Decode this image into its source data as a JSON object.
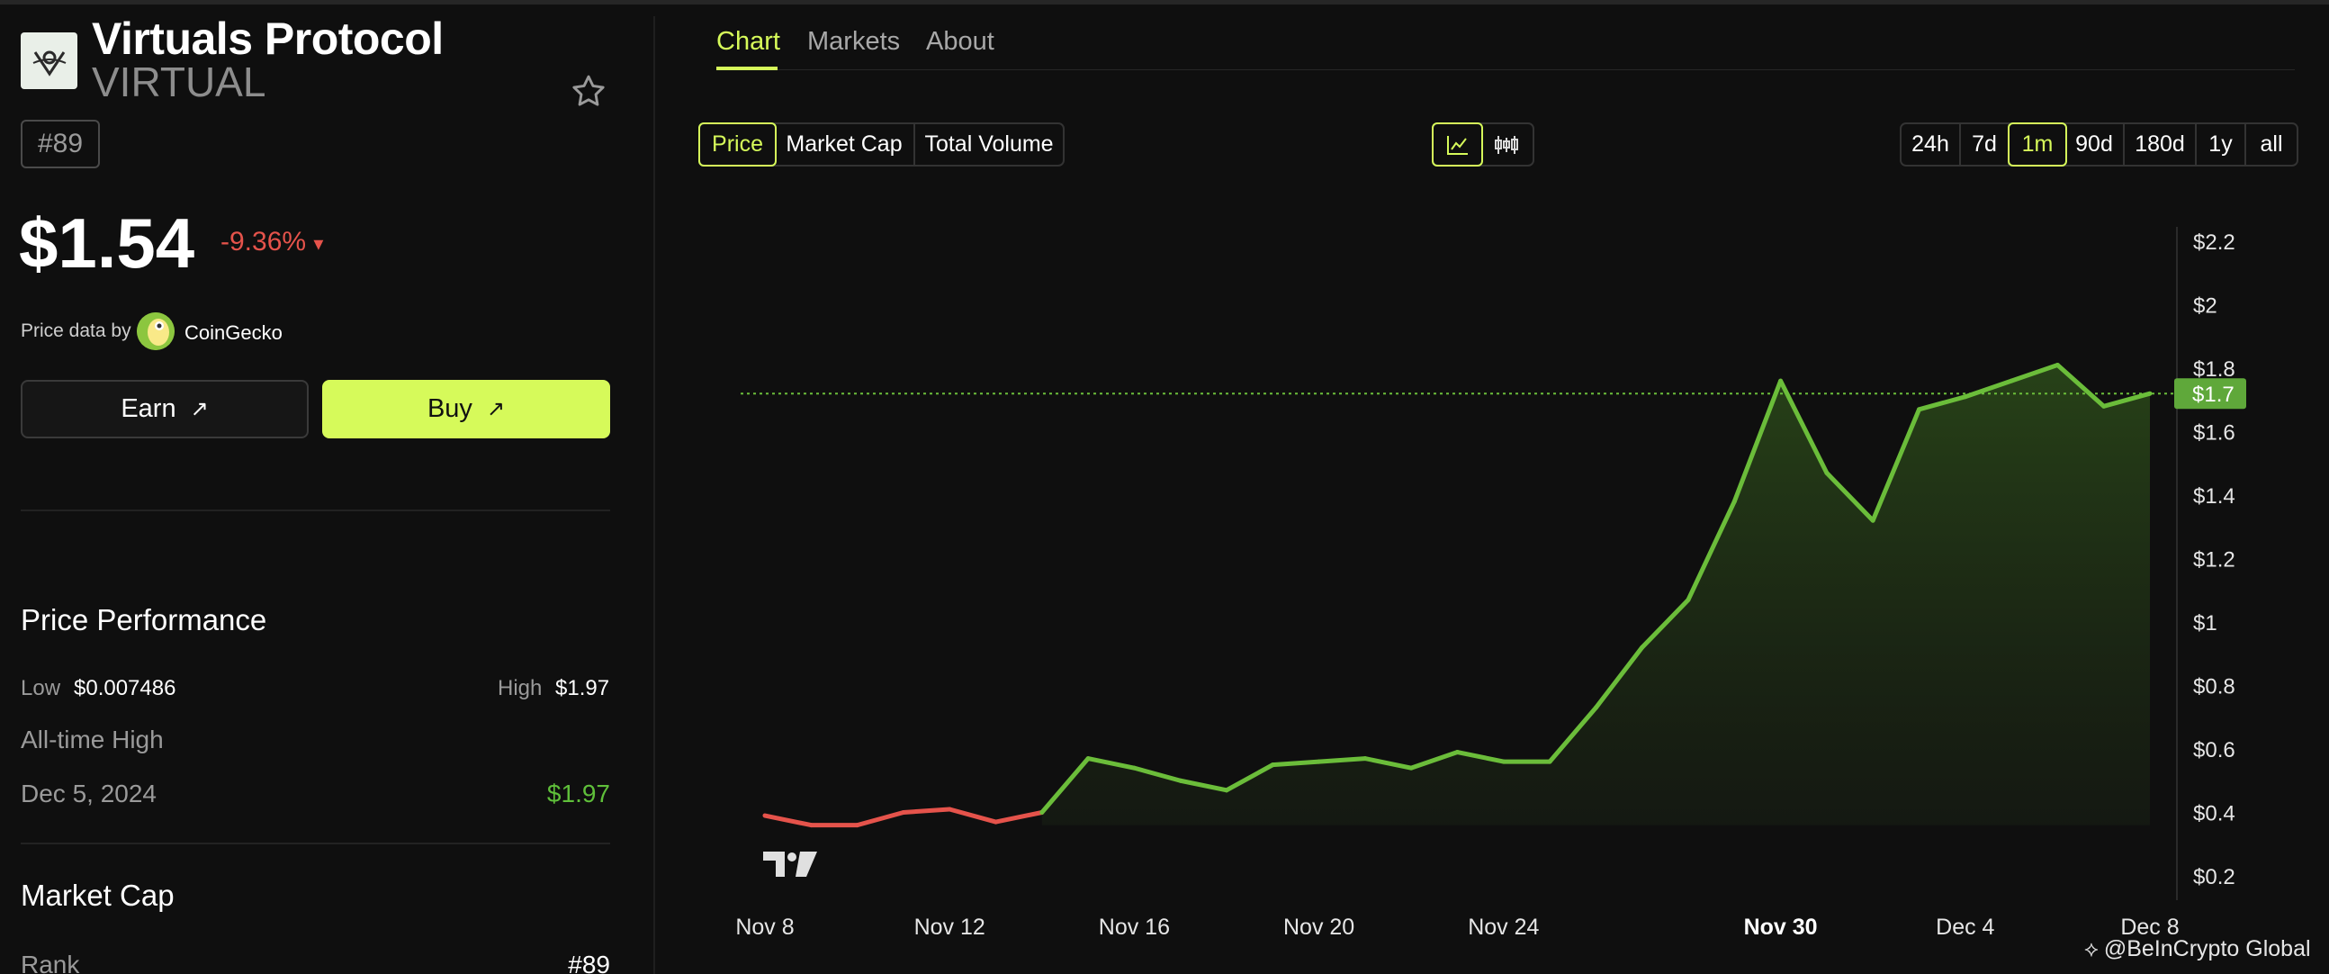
{
  "coin": {
    "name": "Virtuals Protocol",
    "symbol": "VIRTUAL",
    "rank_badge": "#89",
    "price": "$1.54",
    "change": "-9.36%",
    "change_arrow": "▾",
    "price_data_label": "Price data by",
    "price_data_source": "CoinGecko"
  },
  "actions": {
    "earn_label": "Earn",
    "buy_label": "Buy",
    "arrow": "↗"
  },
  "performance": {
    "title": "Price Performance",
    "low_label": "Low",
    "low_value": "$0.007486",
    "high_label": "High",
    "high_value": "$1.97",
    "ath_label": "All-time High",
    "ath_date": "Dec 5, 2024",
    "ath_value": "$1.97"
  },
  "market_cap": {
    "title": "Market Cap",
    "rank_label": "Rank",
    "rank_value": "#89"
  },
  "tabs": [
    "Chart",
    "Markets",
    "About"
  ],
  "metrics": [
    "Price",
    "Market Cap",
    "Total Volume"
  ],
  "ranges": [
    "24h",
    "7d",
    "1m",
    "90d",
    "180d",
    "1y",
    "all"
  ],
  "active_range": "1m",
  "colors": {
    "accent": "#d6fa5a",
    "up": "#6bbd3a",
    "down": "#e5534b"
  },
  "chart_data": {
    "type": "area",
    "x": [
      "Nov 8",
      "Nov 9",
      "Nov 10",
      "Nov 11",
      "Nov 12",
      "Nov 13",
      "Nov 14",
      "Nov 15",
      "Nov 16",
      "Nov 17",
      "Nov 18",
      "Nov 19",
      "Nov 20",
      "Nov 21",
      "Nov 22",
      "Nov 23",
      "Nov 24",
      "Nov 25",
      "Nov 26",
      "Nov 27",
      "Nov 28",
      "Nov 29",
      "Nov 30",
      "Dec 1",
      "Dec 2",
      "Dec 3",
      "Dec 4",
      "Dec 5",
      "Dec 6",
      "Dec 7",
      "Dec 8"
    ],
    "values": [
      0.39,
      0.36,
      0.36,
      0.4,
      0.41,
      0.37,
      0.4,
      0.57,
      0.54,
      0.5,
      0.47,
      0.55,
      0.56,
      0.57,
      0.54,
      0.59,
      0.56,
      0.56,
      0.73,
      0.92,
      1.07,
      1.38,
      1.76,
      1.47,
      1.32,
      1.67,
      1.71,
      1.76,
      1.81,
      1.68,
      1.72
    ],
    "current_price_label": "$1.7",
    "x_tick_labels": [
      "Nov 8",
      "Nov 12",
      "Nov 16",
      "Nov 20",
      "Nov 24",
      "Nov 30",
      "Dec 4",
      "Dec 8"
    ],
    "y_ticks": [
      0.2,
      0.4,
      0.6,
      0.8,
      1,
      1.2,
      1.4,
      1.6,
      1.8,
      2,
      2.2
    ],
    "y_tick_labels": [
      "$0.2",
      "$0.4",
      "$0.6",
      "$0.8",
      "$1",
      "$1.2",
      "$1.4",
      "$1.6",
      "$1.8",
      "$2",
      "$2.2"
    ],
    "ylim": [
      0.2,
      2.2
    ],
    "grid": false
  },
  "watermark": "@BeInCrypto Global"
}
